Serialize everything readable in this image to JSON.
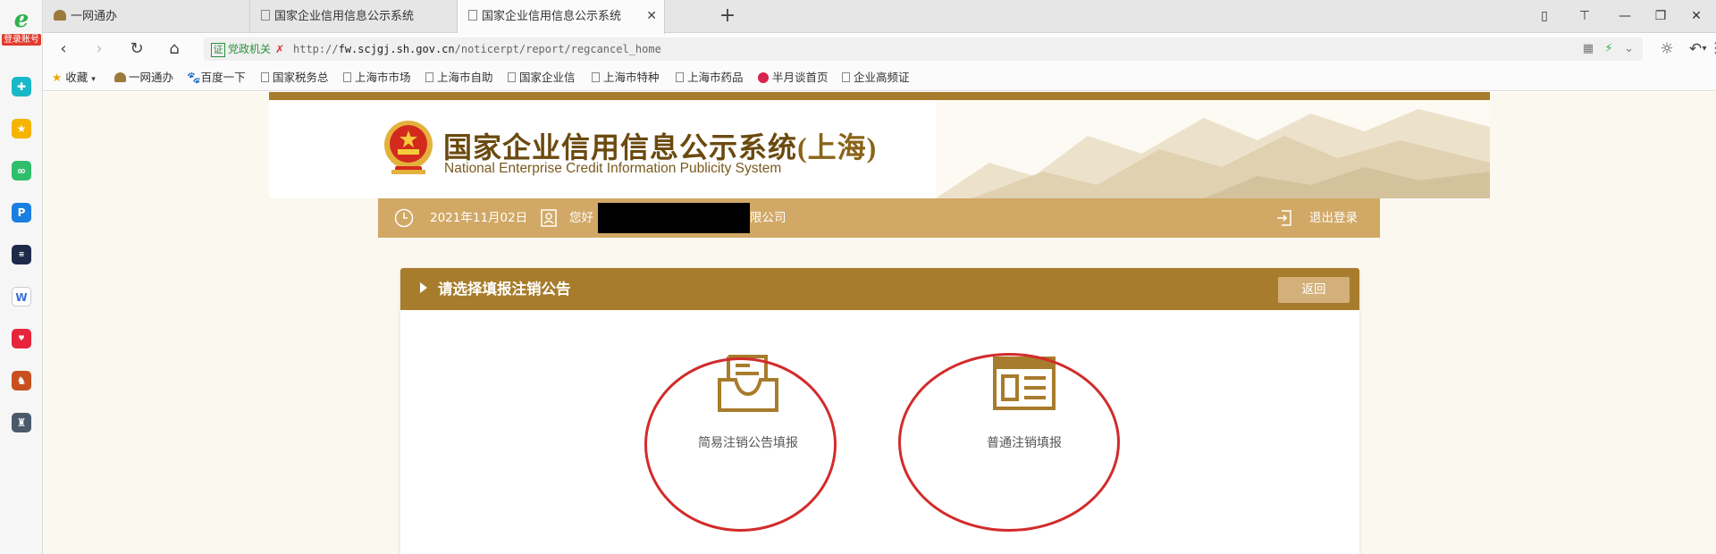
{
  "sidebar": {
    "logo_badge": "登录账号"
  },
  "tabs": [
    {
      "label": "一网通办"
    },
    {
      "label": "国家企业信用信息公示系统"
    },
    {
      "label": "国家企业信用信息公示系统"
    }
  ],
  "address": {
    "cert_label": "党政机关",
    "url_prefix": "http://",
    "url_host": "fw.scjgj.sh.gov.cn",
    "url_path": "/noticerpt/report/regcancel_home"
  },
  "bookmarks": [
    "收藏",
    "一网通办",
    "百度一下",
    "国家税务总",
    "上海市市场",
    "上海市自助",
    "国家企业信",
    "上海市特种",
    "上海市药品",
    "半月谈首页",
    "企业高频证"
  ],
  "site": {
    "title": "国家企业信用信息公示系统",
    "region": "(上海)",
    "subtitle": "National Enterprise Credit Information Publicity System"
  },
  "infobar": {
    "date": "2021年11月02日",
    "greeting": "您好",
    "company_suffix": "限公司",
    "logout": "退出登录"
  },
  "card": {
    "title": "请选择填报注销公告",
    "back_label": "返回"
  },
  "options": [
    {
      "label": "简易注销公告填报"
    },
    {
      "label": "普通注销填报"
    }
  ],
  "colors": {
    "brand_gold": "#a77c2c",
    "infobar": "#d1a865",
    "highlight_circle": "#d22b2b"
  }
}
